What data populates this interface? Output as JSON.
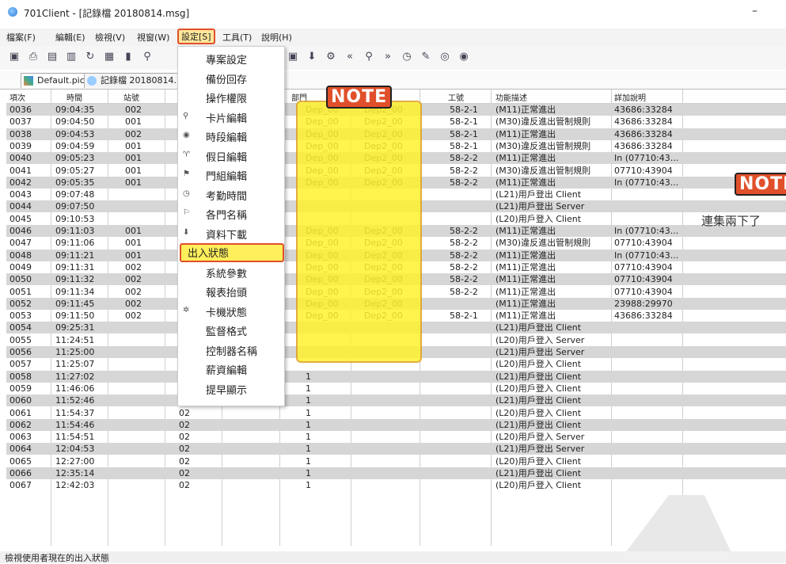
{
  "window": {
    "title": "701Client - [記錄檔 20180814.msg]",
    "minimize": "–"
  },
  "menubar": {
    "items": [
      {
        "label": "檔案(F)"
      },
      {
        "label": "編輯(E)"
      },
      {
        "label": "檢視(V)"
      },
      {
        "label": "視窗(W)"
      },
      {
        "label": "設定[S]"
      },
      {
        "label": "工具(T)"
      },
      {
        "label": "說明(H)"
      }
    ]
  },
  "tabs": [
    {
      "label": "Default.pic"
    },
    {
      "label": "記錄檔 20180814.m"
    }
  ],
  "grid": {
    "headers": [
      "項次",
      "時間",
      "站號",
      "",
      "部門",
      "",
      "工號",
      "功能描述",
      "詳加說明"
    ],
    "rows": [
      [
        "0036",
        "09:04:35",
        "002",
        "(",
        "Dep_00",
        "Dep2_00",
        "58-2-1",
        "(M11)正常進出",
        "43686:33284"
      ],
      [
        "0037",
        "09:04:50",
        "001",
        "(",
        "Dep_00",
        "Dep2_00",
        "58-2-1",
        "(M30)違反進出管制規則",
        "43686:33284"
      ],
      [
        "0038",
        "09:04:53",
        "002",
        "(",
        "Dep_00",
        "Dep2_00",
        "58-2-1",
        "(M11)正常進出",
        "43686:33284"
      ],
      [
        "0039",
        "09:04:59",
        "001",
        "(",
        "Dep_00",
        "Dep2_00",
        "58-2-1",
        "(M30)違反進出管制規則",
        "43686:33284"
      ],
      [
        "0040",
        "09:05:23",
        "001",
        "(",
        "Dep_00",
        "Dep2_00",
        "58-2-2",
        "(M11)正常進出",
        "In  (07710:43..."
      ],
      [
        "0041",
        "09:05:27",
        "001",
        "(",
        "Dep_00",
        "Dep2_00",
        "58-2-2",
        "(M30)違反進出管制規則",
        "07710:43904"
      ],
      [
        "0042",
        "09:05:35",
        "001",
        "(",
        "Dep_00",
        "Dep2_00",
        "58-2-2",
        "(M11)正常進出",
        "In  (07710:43..."
      ],
      [
        "0043",
        "09:07:48",
        "",
        "",
        "",
        "",
        "",
        "(L21)用戶登出  Client",
        ""
      ],
      [
        "0044",
        "09:07:50",
        "",
        "",
        "",
        "",
        "",
        "(L21)用戶登出  Server",
        ""
      ],
      [
        "0045",
        "09:10:53",
        "",
        "",
        "",
        "",
        "",
        "(L20)用戶登入  Client",
        ""
      ],
      [
        "0046",
        "09:11:03",
        "001",
        "(",
        "Dep_00",
        "Dep2_00",
        "58-2-2",
        "(M11)正常進出",
        "In  (07710:43..."
      ],
      [
        "0047",
        "09:11:06",
        "001",
        "(",
        "Dep_00",
        "Dep2_00",
        "58-2-2",
        "(M30)違反進出管制規則",
        "07710:43904"
      ],
      [
        "0048",
        "09:11:21",
        "001",
        "(",
        "Dep_00",
        "Dep2_00",
        "58-2-2",
        "(M11)正常進出",
        "In  (07710:43..."
      ],
      [
        "0049",
        "09:11:31",
        "002",
        "(",
        "Dep_00",
        "Dep2_00",
        "58-2-2",
        "(M11)正常進出",
        "07710:43904"
      ],
      [
        "0050",
        "09:11:32",
        "002",
        "(",
        "Dep_00",
        "Dep2_00",
        "58-2-2",
        "(M11)正常進出",
        "07710:43904"
      ],
      [
        "0051",
        "09:11:34",
        "002",
        "(",
        "Dep_00",
        "Dep2_00",
        "58-2-2",
        "(M11)正常進出",
        "07710:43904"
      ],
      [
        "0052",
        "09:11:45",
        "002",
        "(",
        "Dep_00",
        "Dep2_00",
        "",
        "(M11)正常進出",
        "23988:29970"
      ],
      [
        "0053",
        "09:11:50",
        "002",
        "(",
        "Dep_00",
        "Dep2_00",
        "58-2-1",
        "(M11)正常進出",
        "43686:33284"
      ],
      [
        "0054",
        "09:25:31",
        "",
        "",
        "",
        "",
        "",
        "(L21)用戶登出  Client",
        ""
      ],
      [
        "0055",
        "11:24:51",
        "",
        "",
        "",
        "",
        "",
        "(L20)用戶登入  Server",
        ""
      ],
      [
        "0056",
        "11:25:00",
        "",
        "",
        "",
        "",
        "",
        "(L21)用戶登出  Server",
        ""
      ],
      [
        "0057",
        "11:25:07",
        "",
        "",
        "",
        "",
        "",
        "(L20)用戶登入  Client",
        ""
      ],
      [
        "0058",
        "11:27:02",
        "",
        "02",
        "1",
        "",
        "",
        "(L21)用戶登出  Client",
        ""
      ],
      [
        "0059",
        "11:46:06",
        "",
        "02",
        "1",
        "",
        "",
        "(L20)用戶登入  Client",
        ""
      ],
      [
        "0060",
        "11:52:46",
        "",
        "02",
        "1",
        "",
        "",
        "(L21)用戶登出  Client",
        ""
      ],
      [
        "0061",
        "11:54:37",
        "",
        "02",
        "1",
        "",
        "",
        "(L20)用戶登入  Client",
        ""
      ],
      [
        "0062",
        "11:54:46",
        "",
        "02",
        "1",
        "",
        "",
        "(L21)用戶登出  Client",
        ""
      ],
      [
        "0063",
        "11:54:51",
        "",
        "02",
        "1",
        "",
        "",
        "(L20)用戶登入  Server",
        ""
      ],
      [
        "0064",
        "12:04:53",
        "",
        "02",
        "1",
        "",
        "",
        "(L21)用戶登出  Server",
        ""
      ],
      [
        "0065",
        "12:27:00",
        "",
        "02",
        "1",
        "",
        "",
        "(L20)用戶登入  Client",
        ""
      ],
      [
        "0066",
        "12:35:14",
        "",
        "02",
        "1",
        "",
        "",
        "(L21)用戶登出  Client",
        ""
      ],
      [
        "0067",
        "12:42:03",
        "",
        "02",
        "1",
        "",
        "",
        "(L20)用戶登入  Client",
        ""
      ]
    ]
  },
  "dropdown": {
    "items": [
      {
        "label": "專案設定"
      },
      {
        "label": "備份回存"
      },
      {
        "label": "操作權限"
      },
      {
        "label": "卡片編輯"
      },
      {
        "label": "時段編輯"
      },
      {
        "label": "假日編輯"
      },
      {
        "label": "門組編輯"
      },
      {
        "label": "考勤時間"
      },
      {
        "label": "各門名稱"
      },
      {
        "label": "資料下載"
      },
      {
        "label": "出入狀態"
      },
      {
        "label": "系統參數"
      },
      {
        "label": "報表抬頭"
      },
      {
        "label": "卡機狀態"
      },
      {
        "label": "監督格式"
      },
      {
        "label": "控制器名稱"
      },
      {
        "label": "薪資編輯"
      },
      {
        "label": "提早顯示"
      }
    ],
    "selected": "出入狀態"
  },
  "notes": {
    "badge1": "NOTE",
    "badge2": "NOTE",
    "side_text": "連集兩下了"
  },
  "statusbar": {
    "text": "檢視使用者現在的出入狀態"
  },
  "colors": {
    "highlight": "#fff22f",
    "accent": "#e0502a",
    "shade_row": "#d6d6d6"
  }
}
